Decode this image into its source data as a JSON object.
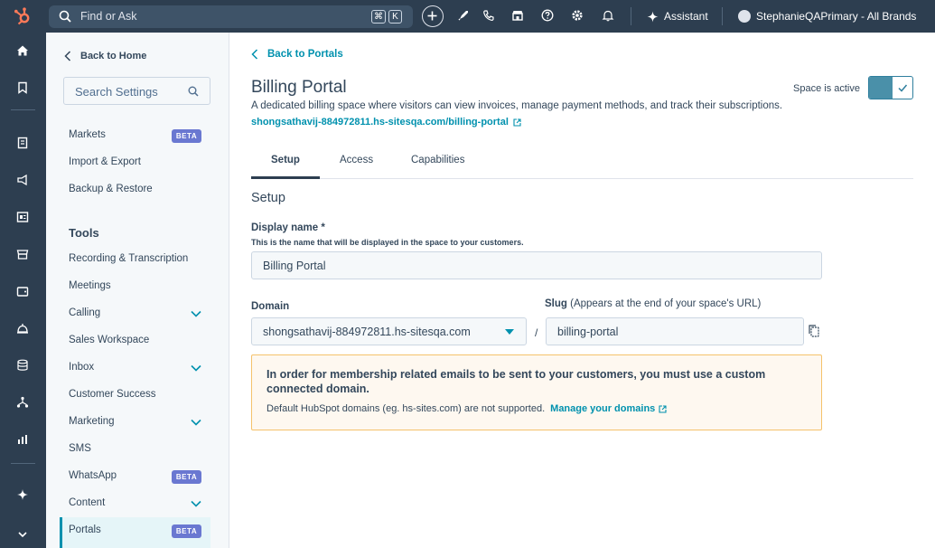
{
  "topbar": {
    "search_placeholder": "Find or Ask",
    "kbd_cmd": "⌘",
    "kbd_k": "K",
    "assistant_label": "Assistant",
    "account_name": "StephanieQAPrimary - All Brands"
  },
  "sidebar": {
    "back_label": "Back to Home",
    "search_placeholder": "Search Settings",
    "items_top": [
      {
        "label": "Markets",
        "badge": "BETA"
      },
      {
        "label": "Import & Export"
      },
      {
        "label": "Backup & Restore"
      }
    ],
    "tools_heading": "Tools",
    "tools_items": [
      {
        "label": "Recording & Transcription"
      },
      {
        "label": "Meetings"
      },
      {
        "label": "Calling"
      },
      {
        "label": "Sales Workspace"
      },
      {
        "label": "Inbox"
      },
      {
        "label": "Customer Success"
      },
      {
        "label": "Marketing"
      },
      {
        "label": "SMS"
      },
      {
        "label": "WhatsApp",
        "badge": "BETA"
      },
      {
        "label": "Content"
      },
      {
        "label": "Portals",
        "badge": "BETA"
      }
    ]
  },
  "main": {
    "back_label": "Back to Portals",
    "title": "Billing Portal",
    "description": "A dedicated billing space where visitors can view invoices, manage payment methods, and track their subscriptions.",
    "url": "shongsathavij-884972811.hs-sitesqa.com/billing-portal",
    "space_active_label": "Space is active",
    "space_active": true,
    "tabs": [
      {
        "label": "Setup",
        "active": true
      },
      {
        "label": "Access"
      },
      {
        "label": "Capabilities"
      }
    ],
    "section_title": "Setup",
    "display_name_label": "Display name *",
    "display_name_help": "This is the name that will be displayed in the space to your customers.",
    "display_name_value": "Billing Portal",
    "domain_label": "Domain",
    "domain_value": "shongsathavij-884972811.hs-sitesqa.com",
    "separator": "/",
    "slug_label": "Slug",
    "slug_hint": "(Appears at the end of your space's URL)",
    "slug_value": "billing-portal",
    "alert_title": "In order for membership related emails to be sent to your customers, you must use a custom connected domain.",
    "alert_body": "Default HubSpot domains (eg. hs-sites.com) are not supported.",
    "alert_link": "Manage your domains"
  },
  "colors": {
    "nav_bg": "#2d3e50",
    "accent": "#0091ae",
    "beta_badge": "#6a78d1",
    "alert_bg": "#fef8f0",
    "alert_border": "#f5c26b",
    "hubspot_orange": "#ff7a59"
  }
}
